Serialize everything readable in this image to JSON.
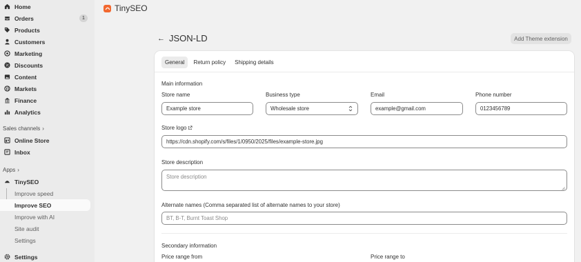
{
  "sidebar": {
    "nav": [
      {
        "label": "Home",
        "icon": "home-icon"
      },
      {
        "label": "Orders",
        "icon": "inbox-icon",
        "badge": "1"
      },
      {
        "label": "Products",
        "icon": "tag-icon"
      },
      {
        "label": "Customers",
        "icon": "person-icon"
      },
      {
        "label": "Marketing",
        "icon": "target-icon"
      },
      {
        "label": "Discounts",
        "icon": "discount-icon"
      },
      {
        "label": "Content",
        "icon": "image-icon"
      },
      {
        "label": "Markets",
        "icon": "globe-icon"
      },
      {
        "label": "Finance",
        "icon": "bank-icon"
      },
      {
        "label": "Analytics",
        "icon": "chart-bars-icon"
      }
    ],
    "sales_channels_label": "Sales channels",
    "channels": [
      {
        "label": "Online Store",
        "icon": "store-icon"
      },
      {
        "label": "Inbox",
        "icon": "chat-icon"
      }
    ],
    "apps_label": "Apps",
    "app_name": "TinySEO",
    "app_items": [
      "Improve speed",
      "Improve SEO",
      "Improve with AI",
      "Site audit",
      "Settings"
    ],
    "active_app_item": "Improve SEO",
    "settings_label": "Settings"
  },
  "topbar": {
    "app_title": "TinySEO"
  },
  "page": {
    "title": "JSON-LD",
    "theme_button": "Add Theme extension",
    "tabs": [
      "General",
      "Return policy",
      "Shipping details"
    ],
    "active_tab": "General"
  },
  "form": {
    "main_title": "Main information",
    "store_name_label": "Store name",
    "store_name_value": "Example store",
    "business_type_label": "Business type",
    "business_type_value": "Wholesale store",
    "email_label": "Email",
    "email_value": "example@gmail.com",
    "phone_label": "Phone number",
    "phone_value": "0123456789",
    "logo_label": "Store logo",
    "logo_value": "https://cdn.shopify.com/s/files/1/0950/2025/files/example-store.jpg",
    "description_label": "Store description",
    "description_placeholder": "Store description",
    "alternate_label": "Alternate names (Comma separated list of alternate names to your store)",
    "alternate_placeholder": "BT, B-T, Burnt Toast Shop",
    "secondary_title": "Secondary information",
    "price_from_label": "Price range from",
    "price_to_label": "Price range to"
  },
  "colors": {
    "accent": "#f2682f",
    "sidebar_bg": "#ebebeb",
    "page_bg": "#f1f1f1"
  }
}
